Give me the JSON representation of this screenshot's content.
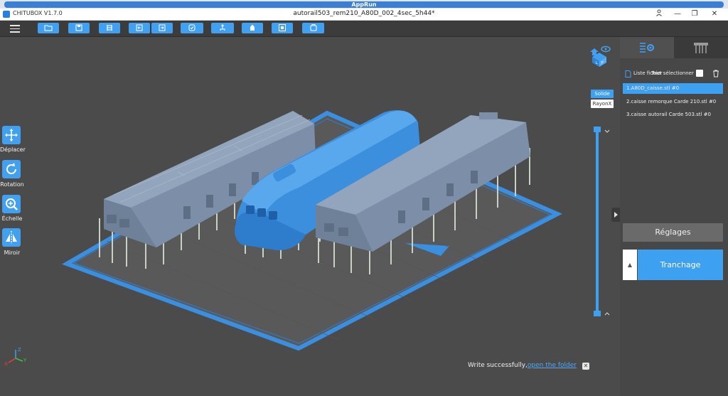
{
  "apprun": {
    "title": "AppRun"
  },
  "titlebar": {
    "app_name": "CHITUBOX V1.7.0",
    "document": "autorail503_rem210_A80D_002_4sec_5h44*",
    "minimize": "—",
    "restore": "❐",
    "close": "✕",
    "user_icon": "user-icon"
  },
  "toolbar": {
    "buttons": [
      "open-file-icon",
      "save-icon",
      "slice-layers-icon",
      "undo-icon",
      "redo-icon",
      "auto-layout-icon",
      "supports-icon",
      "hollow-icon",
      "frame-icon",
      "copy-icon"
    ]
  },
  "left_tools": [
    {
      "label": "Déplacer",
      "icon": "move-icon"
    },
    {
      "label": "Rotation",
      "icon": "rotate-icon"
    },
    {
      "label": "Échelle",
      "icon": "scale-icon"
    },
    {
      "label": "Miroir",
      "icon": "mirror-icon"
    }
  ],
  "view_modes": {
    "solid": "Solide",
    "xray": "RayonX"
  },
  "panel": {
    "file_list_label": "Liste fichier",
    "select_all_label": "Tout sélectionner",
    "files": [
      "1.A80D_caisse.stl #0",
      "2.caisse remorque Carde 210.stl #0",
      "3.caisse autorail Carde 503.stl #0"
    ],
    "settings_button": "Réglages",
    "slice_button": "Tranchage",
    "slice_arrow": "▲"
  },
  "toast": {
    "message": "Write successfully,",
    "link": "open the folder",
    "close": "✕"
  },
  "axis": {
    "x": "X",
    "y": "Y",
    "z": "Z"
  },
  "colors": {
    "accent": "#3ea0f0",
    "model_blue": "#3b8fdc",
    "model_gray": "#7f93ad",
    "support": "#c9d0c5",
    "viewport_bg": "#4b4b4b",
    "plate_edge": "#3a8fe0"
  }
}
